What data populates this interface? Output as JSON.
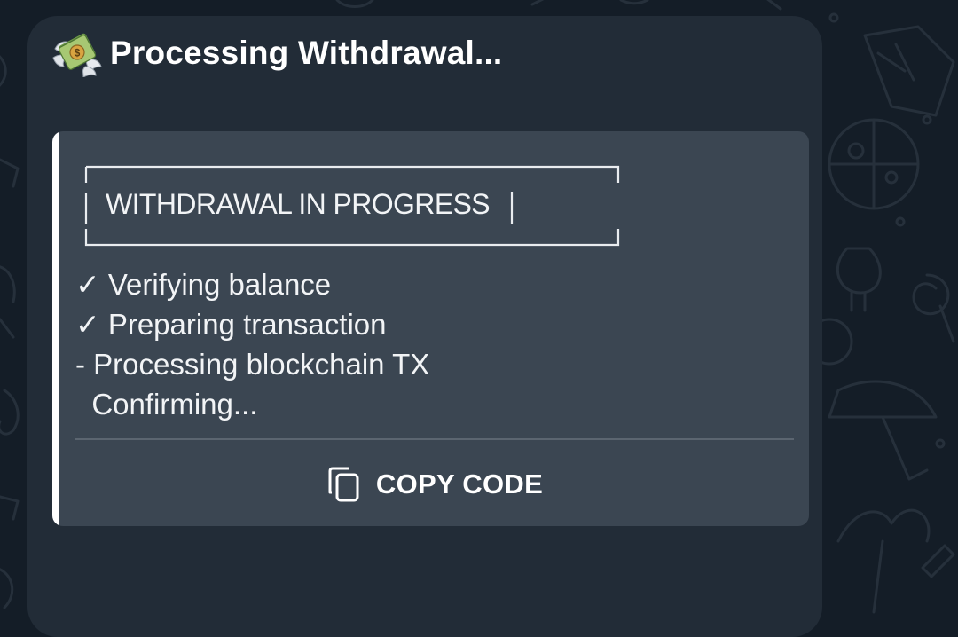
{
  "message": {
    "title": "Processing Withdrawal...",
    "title_icon": "flying-money-icon",
    "code_block": {
      "box_text": "WITHDRAWAL IN PROGRESS",
      "steps": [
        "✓ Verifying balance",
        "✓ Preparing transaction",
        "- Processing blockchain TX",
        "  Confirming..."
      ],
      "copy_button": {
        "label": "COPY CODE",
        "icon": "copy-icon"
      }
    }
  },
  "colors": {
    "wallpaper": "#141d27",
    "bubble": "#222c37",
    "code_block": "#3b4652",
    "accent_bar": "#ffffff",
    "text": "#ffffff"
  }
}
